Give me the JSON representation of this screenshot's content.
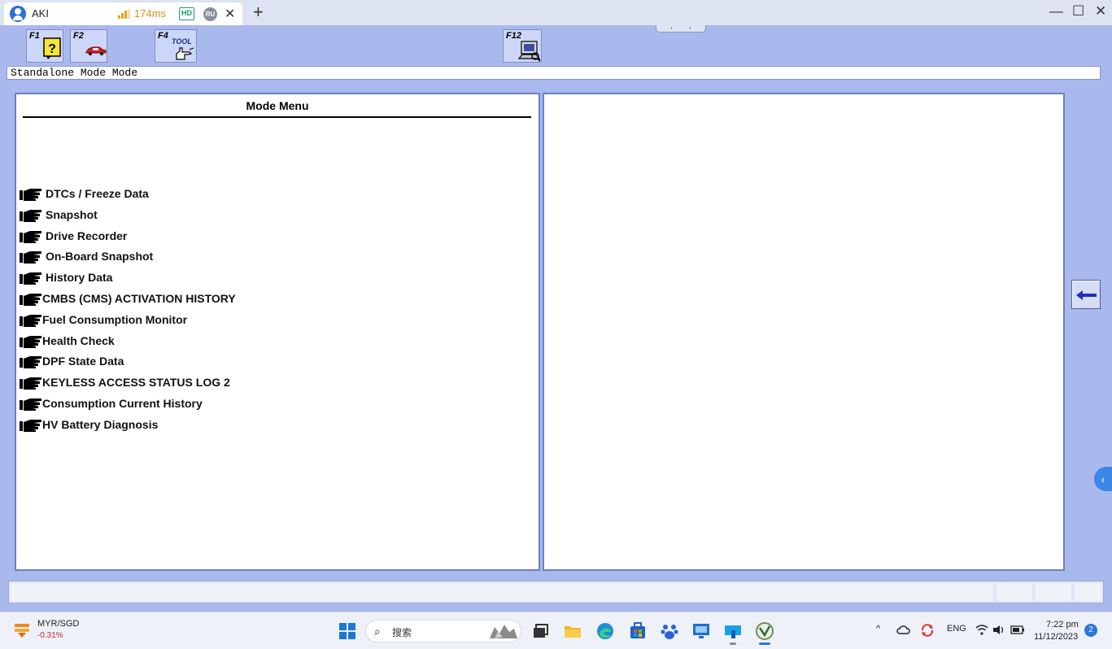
{
  "browser": {
    "tab_title": "AKI",
    "latency": "174ms",
    "hd_badge": "HD",
    "ru_badge": "RU",
    "close_glyph": "✕",
    "newtab_glyph": "+",
    "window_controls": {
      "minimize": "—",
      "maximize": "☐",
      "close": "✕"
    },
    "signal_color": "#e8a417"
  },
  "toolbar": {
    "keys": [
      {
        "label": "F1",
        "icon": "help-icon"
      },
      {
        "label": "F2",
        "icon": "car-icon"
      },
      {
        "label": "F4",
        "icon": "tool-icon",
        "icon_text": "TOOL"
      },
      {
        "label": "F12",
        "icon": "computer-icon"
      }
    ]
  },
  "mode_bar": {
    "text": "Standalone Mode Mode"
  },
  "left_panel": {
    "title": "Mode Menu",
    "items": [
      "DTCs / Freeze Data",
      "Snapshot",
      "Drive Recorder",
      "On-Board Snapshot",
      "History Data",
      "CMBS (CMS) ACTIVATION HISTORY",
      "Fuel Consumption Monitor",
      "Health Check",
      "DPF State Data",
      "KEYLESS ACCESS STATUS LOG 2",
      "Consumption Current History",
      "HV Battery Diagnosis"
    ]
  },
  "back_button": {
    "icon": "left-arrow-icon",
    "color": "#1d2fc4"
  },
  "side_tab": {
    "glyph": "‹"
  },
  "taskbar": {
    "widget_pair": "MYR/SGD",
    "widget_change": "-0.31%",
    "search_glyph": "⌕",
    "search_placeholder": "搜索",
    "tray_chevron": "^",
    "language": "ENG",
    "time": "7:22 pm",
    "date": "11/12/2023",
    "notification_count": "2"
  },
  "colors": {
    "app_background": "#a9b9ee",
    "panel_border": "#6c7fbf",
    "accent_blue": "#2b78d8"
  }
}
